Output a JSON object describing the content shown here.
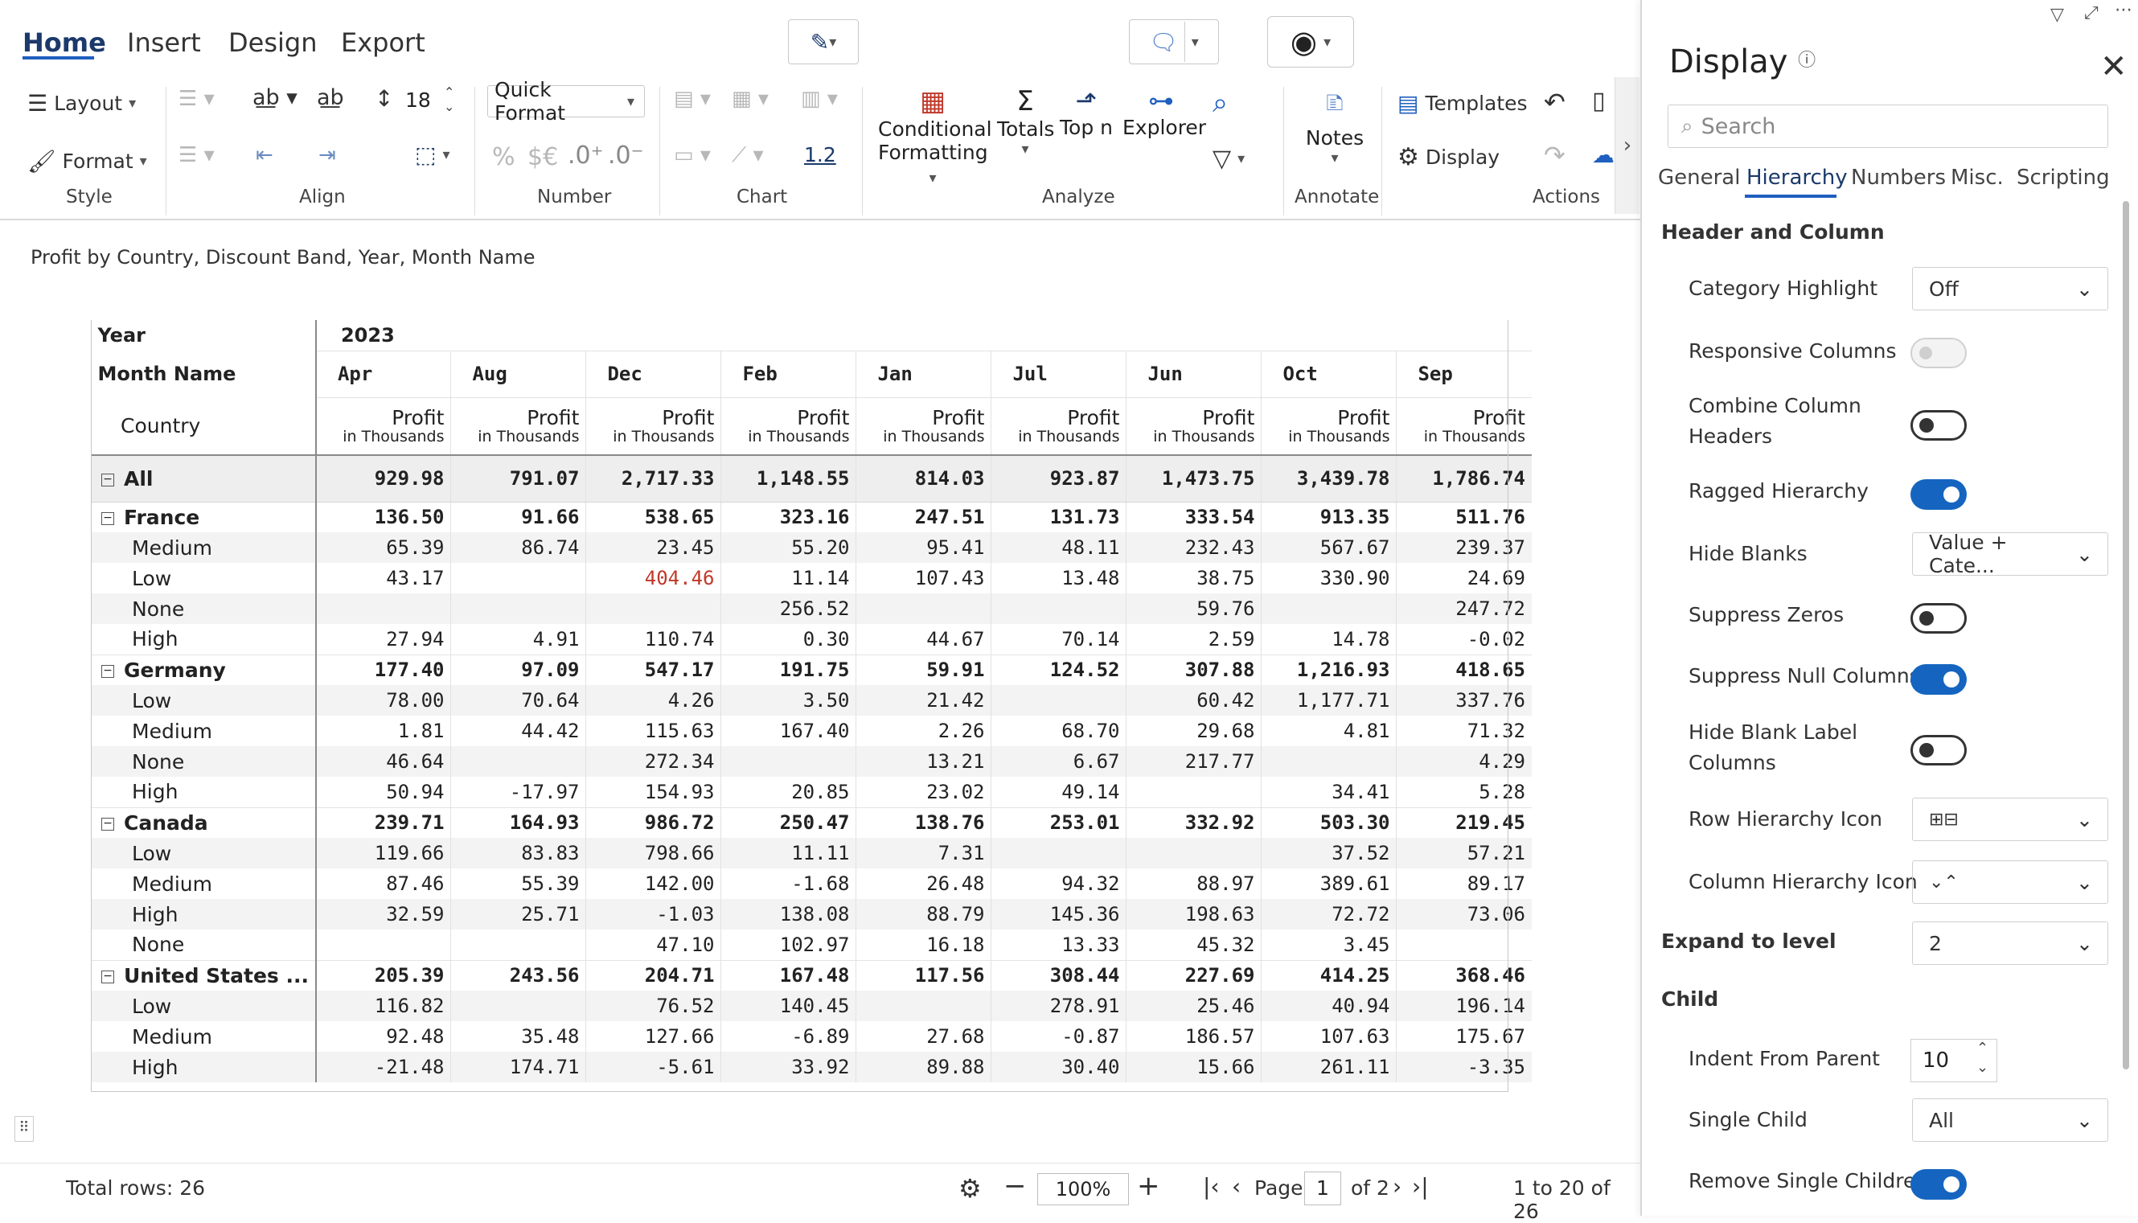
{
  "ribbon": {
    "tabs": [
      "Home",
      "Insert",
      "Design",
      "Export"
    ],
    "active_tab": "Home",
    "font_size": "18",
    "quick_format": "Quick Format",
    "decimal_label": "1.2",
    "buttons": {
      "layout": "Layout",
      "format": "Format",
      "cond1": "Conditional",
      "cond2": "Formatting",
      "totals": "Totals",
      "topn": "Top n",
      "explorer": "Explorer",
      "notes": "Notes",
      "templates": "Templates",
      "display": "Display"
    },
    "groups": {
      "style": "Style",
      "align": "Align",
      "number": "Number",
      "chart": "Chart",
      "analyze": "Analyze",
      "annotate": "Annotate",
      "actions": "Actions"
    },
    "number_symbols": {
      "percent": "%",
      "currency": "$€"
    }
  },
  "report": {
    "title": "Profit by Country, Discount Band, Year, Month Name",
    "header_year_label": "Year",
    "header_year_value": "2023",
    "header_month_label": "Month Name",
    "header_country_label": "Country",
    "measure_name": "Profit",
    "measure_unit": "in Thousands",
    "months": [
      "Apr",
      "Aug",
      "Dec",
      "Feb",
      "Jan",
      "Jul",
      "Jun",
      "Oct",
      "Sep"
    ],
    "rows": [
      {
        "label": "All",
        "level": 0,
        "values": [
          "929.98",
          "791.07",
          "2,717.33",
          "1,148.55",
          "814.03",
          "923.87",
          "1,473.75",
          "3,439.78",
          "1,786.74"
        ]
      },
      {
        "label": "France",
        "level": 1,
        "values": [
          "136.50",
          "91.66",
          "538.65",
          "323.16",
          "247.51",
          "131.73",
          "333.54",
          "913.35",
          "511.76"
        ]
      },
      {
        "label": "Medium",
        "level": 2,
        "values": [
          "65.39",
          "86.74",
          "23.45",
          "55.20",
          "95.41",
          "48.11",
          "232.43",
          "567.67",
          "239.37"
        ]
      },
      {
        "label": "Low",
        "level": 2,
        "values": [
          "43.17",
          "",
          "404.46",
          "11.14",
          "107.43",
          "13.48",
          "38.75",
          "330.90",
          "24.69"
        ],
        "highlight_index": 2
      },
      {
        "label": "None",
        "level": 2,
        "values": [
          "",
          "",
          "",
          "256.52",
          "",
          "",
          "59.76",
          "",
          "247.72"
        ]
      },
      {
        "label": "High",
        "level": 2,
        "values": [
          "27.94",
          "4.91",
          "110.74",
          "0.30",
          "44.67",
          "70.14",
          "2.59",
          "14.78",
          "-0.02"
        ]
      },
      {
        "label": "Germany",
        "level": 1,
        "values": [
          "177.40",
          "97.09",
          "547.17",
          "191.75",
          "59.91",
          "124.52",
          "307.88",
          "1,216.93",
          "418.65"
        ]
      },
      {
        "label": "Low",
        "level": 2,
        "values": [
          "78.00",
          "70.64",
          "4.26",
          "3.50",
          "21.42",
          "",
          "60.42",
          "1,177.71",
          "337.76"
        ]
      },
      {
        "label": "Medium",
        "level": 2,
        "values": [
          "1.81",
          "44.42",
          "115.63",
          "167.40",
          "2.26",
          "68.70",
          "29.68",
          "4.81",
          "71.32"
        ]
      },
      {
        "label": "None",
        "level": 2,
        "values": [
          "46.64",
          "",
          "272.34",
          "",
          "13.21",
          "6.67",
          "217.77",
          "",
          "4.29"
        ]
      },
      {
        "label": "High",
        "level": 2,
        "values": [
          "50.94",
          "-17.97",
          "154.93",
          "20.85",
          "23.02",
          "49.14",
          "",
          "34.41",
          "5.28"
        ]
      },
      {
        "label": "Canada",
        "level": 1,
        "values": [
          "239.71",
          "164.93",
          "986.72",
          "250.47",
          "138.76",
          "253.01",
          "332.92",
          "503.30",
          "219.45"
        ]
      },
      {
        "label": "Low",
        "level": 2,
        "values": [
          "119.66",
          "83.83",
          "798.66",
          "11.11",
          "7.31",
          "",
          "",
          "37.52",
          "57.21"
        ]
      },
      {
        "label": "Medium",
        "level": 2,
        "values": [
          "87.46",
          "55.39",
          "142.00",
          "-1.68",
          "26.48",
          "94.32",
          "88.97",
          "389.61",
          "89.17"
        ]
      },
      {
        "label": "High",
        "level": 2,
        "values": [
          "32.59",
          "25.71",
          "-1.03",
          "138.08",
          "88.79",
          "145.36",
          "198.63",
          "72.72",
          "73.06"
        ]
      },
      {
        "label": "None",
        "level": 2,
        "values": [
          "",
          "",
          "47.10",
          "102.97",
          "16.18",
          "13.33",
          "45.32",
          "3.45",
          ""
        ]
      },
      {
        "label": "United States ...",
        "level": 1,
        "values": [
          "205.39",
          "243.56",
          "204.71",
          "167.48",
          "117.56",
          "308.44",
          "227.69",
          "414.25",
          "368.46"
        ]
      },
      {
        "label": "Low",
        "level": 2,
        "values": [
          "116.82",
          "",
          "76.52",
          "140.45",
          "",
          "278.91",
          "25.46",
          "40.94",
          "196.14"
        ]
      },
      {
        "label": "Medium",
        "level": 2,
        "values": [
          "92.48",
          "35.48",
          "127.66",
          "-6.89",
          "27.68",
          "-0.87",
          "186.57",
          "107.63",
          "175.67"
        ]
      },
      {
        "label": "High",
        "level": 2,
        "values": [
          "-21.48",
          "174.71",
          "-5.61",
          "33.92",
          "89.88",
          "30.40",
          "15.66",
          "261.11",
          "-3.35"
        ]
      }
    ]
  },
  "footer": {
    "total_rows": "Total rows: 26",
    "zoom": "100%",
    "page_label": "Page",
    "page_value": "1",
    "page_of": "of 2",
    "range": "1 to 20 of 26"
  },
  "panel": {
    "title": "Display",
    "search_placeholder": "Search",
    "tabs": [
      "General",
      "Hierarchy",
      "Numbers",
      "Misc.",
      "Scripting"
    ],
    "active_tab": "Hierarchy",
    "section_header": "Header and Column",
    "category_highlight_label": "Category Highlight",
    "category_highlight_value": "Off",
    "responsive_columns_label": "Responsive Columns",
    "combine_headers_label1": "Combine Column",
    "combine_headers_label2": "Headers",
    "ragged_label": "Ragged Hierarchy",
    "hide_blanks_label": "Hide Blanks",
    "hide_blanks_value": "Value + Cate...",
    "suppress_zeros_label": "Suppress Zeros",
    "suppress_null_label": "Suppress Null Columns",
    "hide_blank_label1": "Hide Blank Label",
    "hide_blank_label2": "Columns",
    "row_icon_label": "Row Hierarchy Icon",
    "col_icon_label": "Column Hierarchy Icon",
    "expand_label": "Expand to level",
    "expand_value": "2",
    "child_header": "Child",
    "indent_label": "Indent From Parent",
    "indent_value": "10",
    "single_child_label": "Single Child",
    "single_child_value": "All",
    "remove_single_label": "Remove Single Children",
    "toggles": {
      "responsive_columns": "disabled",
      "combine_headers": "off",
      "ragged": "on",
      "suppress_zeros": "off",
      "suppress_null": "on",
      "hide_blank_label": "off",
      "remove_single": "on"
    },
    "colors": {
      "accent": "#1565c0",
      "negative_highlight": "#c0392b"
    }
  }
}
